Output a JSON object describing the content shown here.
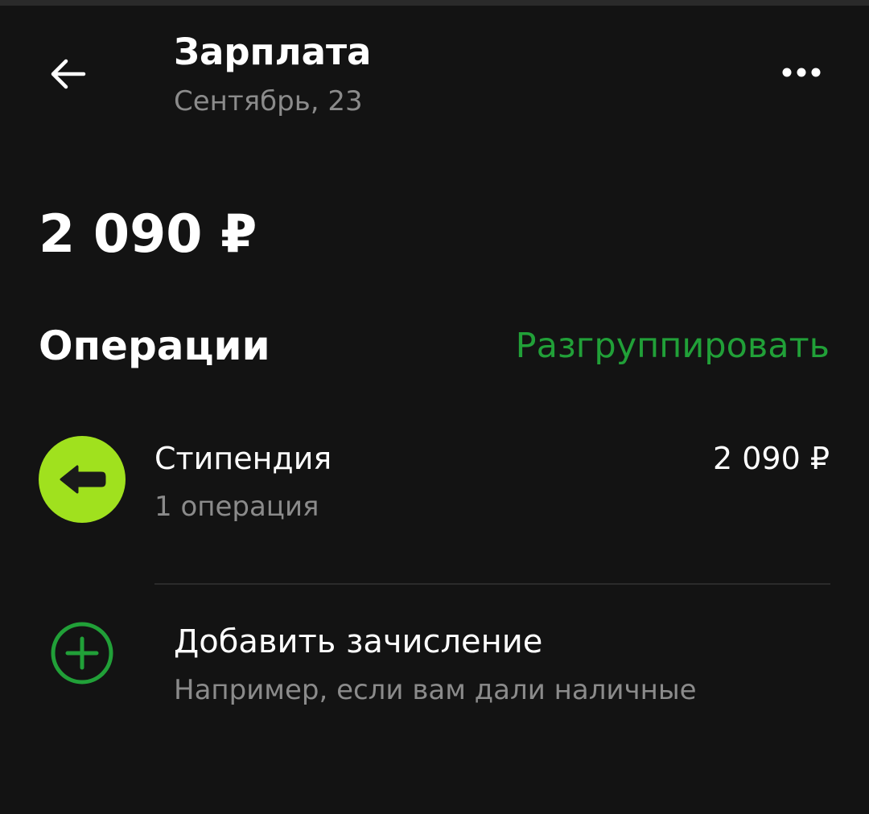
{
  "header": {
    "title": "Зарплата",
    "subtitle": "Сентябрь, 23",
    "back_icon": "arrow-left-icon",
    "more_icon": "more-horizontal-icon"
  },
  "summary": {
    "amount": "2 090 ₽"
  },
  "operations_section": {
    "title": "Операции",
    "action_label": "Разгруппировать",
    "action_color": "#21a038"
  },
  "operations": [
    {
      "title": "Стипендия",
      "count_label": "1 операция",
      "amount": "2 090 ₽",
      "icon": "incoming-arrow-icon",
      "icon_bg_color": "#a0e11e"
    }
  ],
  "add_income": {
    "title": "Добавить зачисление",
    "hint": "Например, если вам дали наличные",
    "icon": "plus-circle-icon",
    "icon_color": "#21a038"
  },
  "colors": {
    "background": "#131313",
    "text_primary": "#ffffff",
    "text_secondary": "#8b8b8b",
    "accent": "#21a038"
  }
}
